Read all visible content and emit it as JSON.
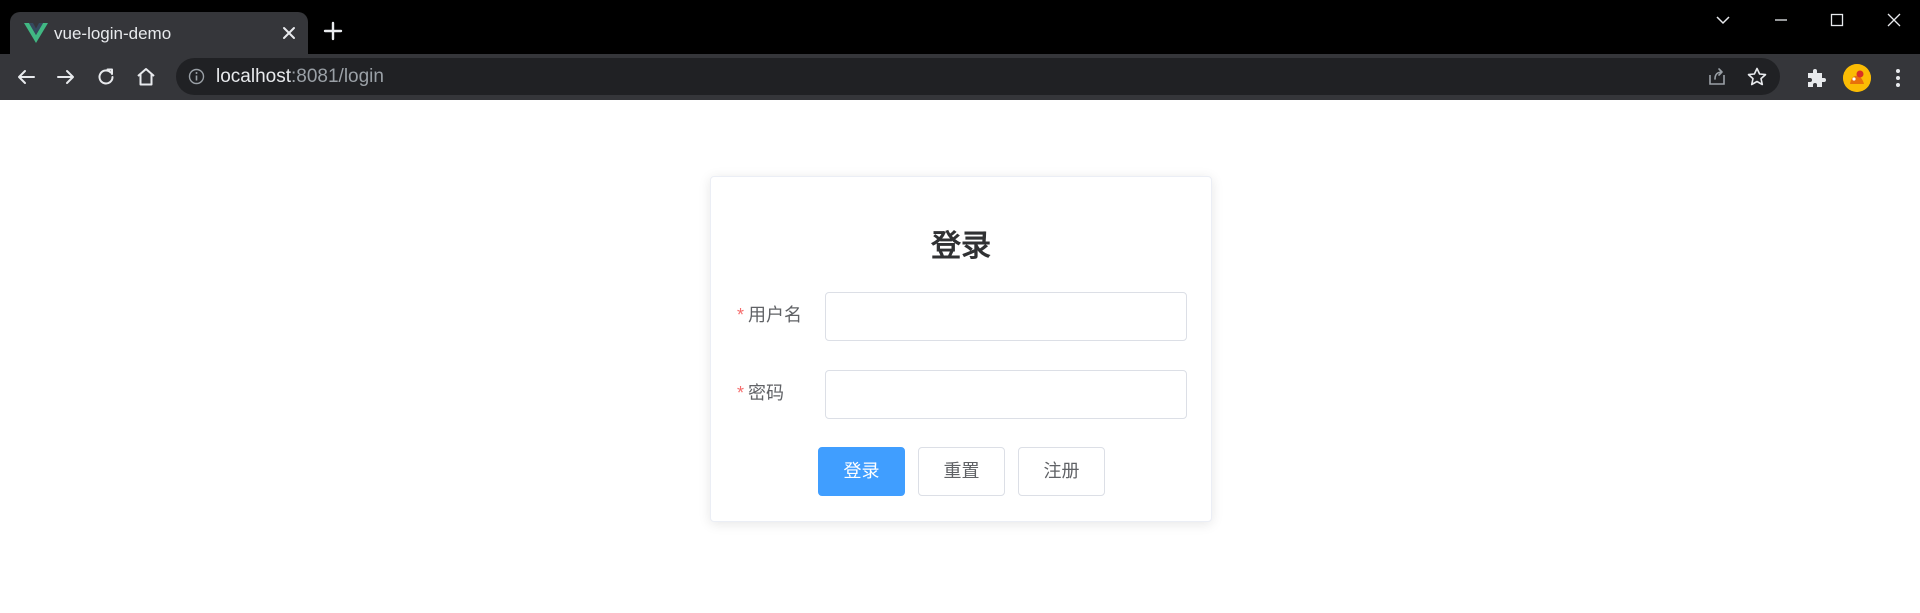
{
  "browser": {
    "tab": {
      "title": "vue-login-demo",
      "favicon": "vue-logo-icon",
      "favicon_color": "#41b883"
    },
    "address": {
      "host": "localhost",
      "rest": ":8081/login"
    }
  },
  "login": {
    "title": "登录",
    "required_mark": "*",
    "username_label": "用户名",
    "username_value": "",
    "password_label": "密码",
    "password_value": "",
    "buttons": {
      "login": "登录",
      "reset": "重置",
      "register": "注册"
    }
  },
  "colors": {
    "primary": "#409eff",
    "required": "#f56c6c",
    "border": "#dcdfe6",
    "text": "#606266",
    "title": "#303133"
  }
}
